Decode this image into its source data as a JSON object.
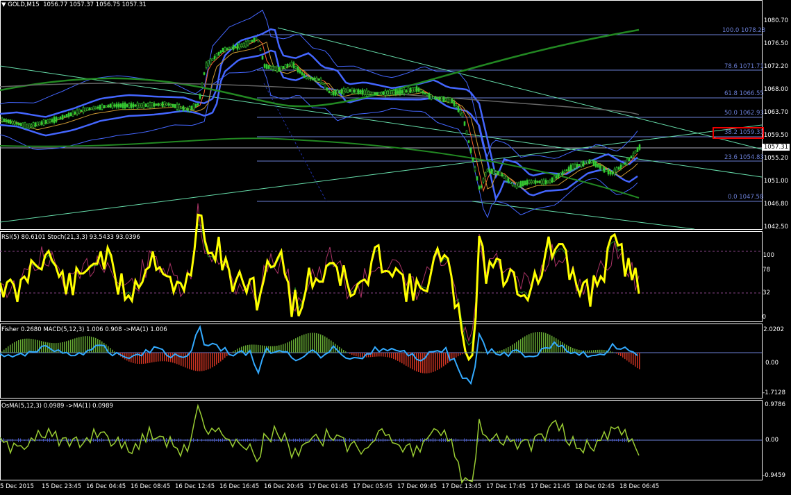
{
  "header": {
    "symbol": "GOLD,M15",
    "ohlc": "1056.77 1057.37 1056.75 1057.31"
  },
  "price_axis": [
    "1080.70",
    "1076.50",
    "1072.20",
    "1068.00",
    "1063.70",
    "1059.50",
    "1055.20",
    "1051.00",
    "1046.80",
    "1042.50"
  ],
  "current_price": "1057.31",
  "fib_levels": [
    {
      "label": "100.0 1078.28",
      "highlight": false
    },
    {
      "label": "78.6 1071.71",
      "highlight": false
    },
    {
      "label": "61.8 1066.55",
      "highlight": false
    },
    {
      "label": "50.0 1062.93",
      "highlight": false
    },
    {
      "label": "38.2 1059.31",
      "highlight": true
    },
    {
      "label": "23.6 1054.83",
      "highlight": false
    },
    {
      "label": "0.0 1047.58",
      "highlight": false
    }
  ],
  "rsi_panel": {
    "title": "RSI(5) 80.6101  Stoch(21,3,3) 93.5433 93.0396",
    "axis": [
      "100",
      "78",
      "32",
      "0"
    ]
  },
  "macd_panel": {
    "title": "Fisher 0.2680  MACD(5,12,3) 1.006 0.908  ->MA(1) 1.006",
    "axis": [
      "2.0202",
      "0.00",
      "-1.7128"
    ]
  },
  "osma_panel": {
    "title": "OsMA(5,12,3) 0.0989  ->MA(1) 0.0989",
    "axis": [
      "0.9786",
      "0.00",
      "-0.9459"
    ]
  },
  "time_axis": [
    "5 Dec 2015",
    "15 Dec 23:45",
    "16 Dec 04:45",
    "16 Dec 08:45",
    "16 Dec 12:45",
    "16 Dec 16:45",
    "16 Dec 20:45",
    "17 Dec 01:45",
    "17 Dec 05:45",
    "17 Dec 09:45",
    "17 Dec 13:45",
    "17 Dec 17:45",
    "17 Dec 21:45",
    "18 Dec 02:45",
    "18 Dec 06:45"
  ],
  "colors": {
    "background": "#000000",
    "bull_candle": "#33cc33",
    "rsi": "#ffff00",
    "macd_hist_pos": "#66aa33",
    "macd_hist_neg": "#cc3322",
    "macd_line": "#33aaff",
    "osma": "#99cc33",
    "fib": "#6b7fd6",
    "bands": "#4466ff",
    "trendline": "#66ddaa"
  }
}
